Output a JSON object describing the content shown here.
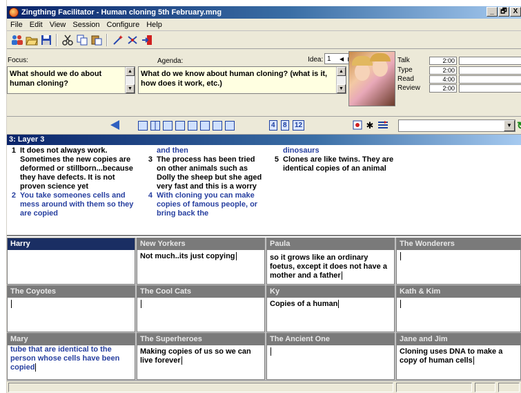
{
  "window": {
    "title": "Zingthing Facilitator - Human cloning 5th February.mng",
    "controls": [
      "_",
      "🗗",
      "X"
    ]
  },
  "menu": [
    "File",
    "Edit",
    "View",
    "Session",
    "Configure",
    "Help"
  ],
  "toolbar": {
    "buttons": [
      "people-icon",
      "open-icon",
      "save-icon",
      "cut-icon",
      "copy-icon",
      "paste-icon",
      "wand-icon",
      "shuffle-icon",
      "exit-icon"
    ]
  },
  "focus": {
    "label": "Focus:",
    "text": "What should we do about human cloning?"
  },
  "agenda": {
    "label": "Agenda:",
    "text": "What do we know about human cloning? (what is it, how does it work, etc.)"
  },
  "idea_selector": {
    "label": "Idea:",
    "value": "1"
  },
  "timers": [
    {
      "name": "Talk",
      "value": "2:00"
    },
    {
      "name": "Type",
      "value": "2:00"
    },
    {
      "name": "Read",
      "value": "4:00"
    },
    {
      "name": "Review",
      "value": "2:00"
    }
  ],
  "nav": {
    "count_buttons": [
      "4",
      "8",
      "12"
    ]
  },
  "layer": {
    "title": "3: Layer 3"
  },
  "ideas": [
    {
      "num": "1",
      "text": "It does not always work. Sometimes the new copies are deformed or stillborn...because they have  defects. It is not proven science yet",
      "color": "black"
    },
    {
      "num": "2",
      "text": "You take someones cells and mess around with them so they are copied",
      "color": "blue"
    },
    {
      "num": "",
      "text": "and then",
      "color": "blue"
    },
    {
      "num": "3",
      "text": "The process has been tried on other animals such as Dolly the sheep but she aged very fast and this is a worry",
      "color": "black"
    },
    {
      "num": "4",
      "text": "With cloning you can make copies of famous people, or bring back the",
      "color": "blue"
    },
    {
      "num": "",
      "text": "dinosaurs",
      "color": "blue"
    },
    {
      "num": "5",
      "text": "Clones are like twins. They are identical copies of an animal",
      "color": "black"
    }
  ],
  "participants": [
    {
      "name": "Harry",
      "text": "",
      "active": true,
      "caret": false,
      "color": "black"
    },
    {
      "name": "New Yorkers",
      "text": "Not much..its just copying",
      "active": false,
      "caret": true,
      "color": "black"
    },
    {
      "name": "Paula",
      "text": "so it grows like an ordinary foetus, except it does not have a mother and a father",
      "active": false,
      "caret": true,
      "color": "black"
    },
    {
      "name": "The Wonderers",
      "text": "",
      "active": false,
      "caret": true,
      "color": "black"
    },
    {
      "name": "The Coyotes",
      "text": "",
      "active": false,
      "caret": true,
      "color": "black"
    },
    {
      "name": "The Cool Cats",
      "text": "",
      "active": false,
      "caret": true,
      "color": "black"
    },
    {
      "name": "Ky",
      "text": "Copies of a human",
      "active": false,
      "caret": true,
      "color": "black"
    },
    {
      "name": "Kath & Kim",
      "text": "",
      "active": false,
      "caret": true,
      "color": "black"
    },
    {
      "name": "Mary",
      "text": "tube that are identical to the person whose cells have been copied",
      "active": false,
      "caret": true,
      "color": "blue"
    },
    {
      "name": "The Superheroes",
      "text": "Making copies of us so we can live forever",
      "active": false,
      "caret": true,
      "color": "black"
    },
    {
      "name": "The Ancient One",
      "text": "",
      "active": false,
      "caret": true,
      "color": "black"
    },
    {
      "name": "Jane and Jim",
      "text": "Cloning uses DNA to make a copy of human cells",
      "active": false,
      "caret": true,
      "color": "black"
    }
  ]
}
